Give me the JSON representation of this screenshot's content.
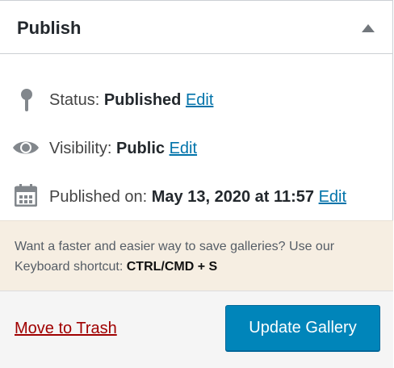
{
  "header": {
    "title": "Publish"
  },
  "status": {
    "label": "Status:",
    "value": "Published",
    "edit": "Edit"
  },
  "visibility": {
    "label": "Visibility:",
    "value": "Public",
    "edit": "Edit"
  },
  "published_on": {
    "label": "Published on:",
    "value": "May 13, 2020 at 11:57",
    "edit": "Edit"
  },
  "notice": {
    "text": "Want a faster and easier way to save galleries? Use our Keyboard shortcut:",
    "shortcut": "CTRL/CMD + S"
  },
  "footer": {
    "trash_label": "Move to Trash",
    "update_label": "Update Gallery"
  },
  "colors": {
    "link": "#0073aa",
    "trash": "#a00000",
    "button": "#0085ba",
    "notice_bg": "#f6eee2"
  },
  "icons": {
    "toggle": "triangle-up-icon",
    "status": "pin-icon",
    "visibility": "eye-icon",
    "date": "calendar-icon"
  }
}
